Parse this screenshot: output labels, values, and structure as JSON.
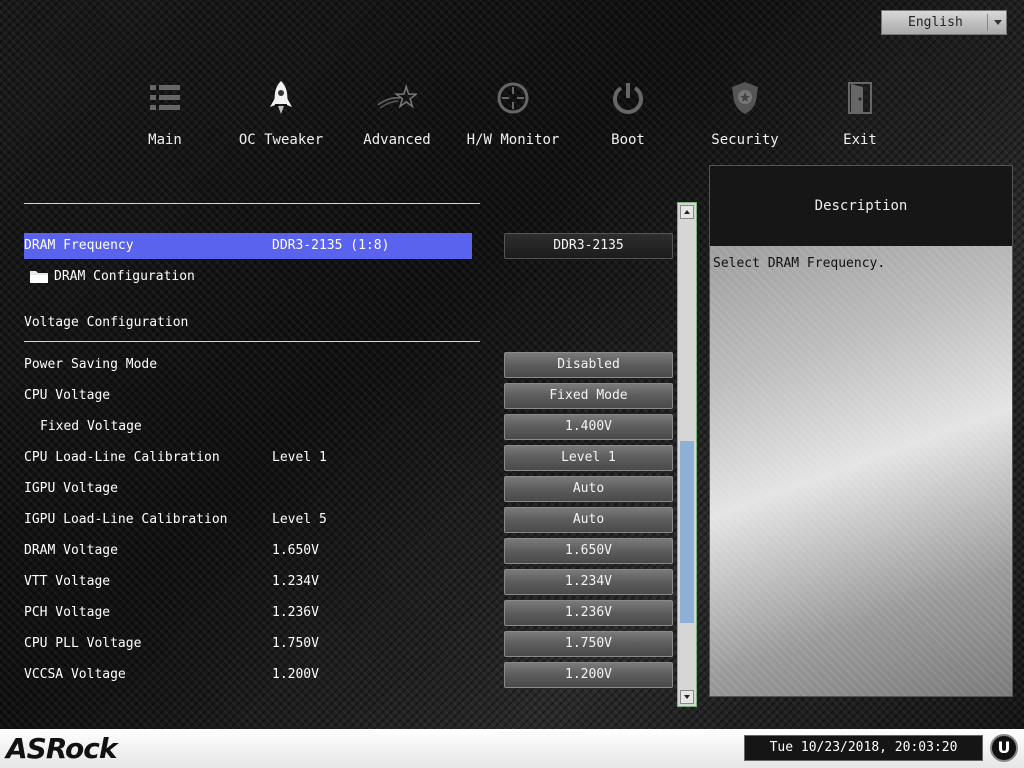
{
  "language": {
    "selected": "English"
  },
  "nav": {
    "items": [
      {
        "label": "Main",
        "icon": "list-icon"
      },
      {
        "label": "OC Tweaker",
        "icon": "rocket-icon"
      },
      {
        "label": "Advanced",
        "icon": "star-icon"
      },
      {
        "label": "H/W Monitor",
        "icon": "crosshair-icon"
      },
      {
        "label": "Boot",
        "icon": "power-icon"
      },
      {
        "label": "Security",
        "icon": "shield-icon"
      },
      {
        "label": "Exit",
        "icon": "door-icon"
      }
    ],
    "active": "OC Tweaker"
  },
  "settings": {
    "dram_frequency": {
      "label": "DRAM Frequency",
      "value": "DDR3-2135 (1:8)",
      "option": "DDR3-2135"
    },
    "dram_configuration": {
      "label": "DRAM Configuration"
    },
    "voltage_section": "Voltage Configuration",
    "rows": [
      {
        "label": "Power Saving Mode",
        "value": "",
        "option": "Disabled"
      },
      {
        "label": "CPU Voltage",
        "value": "",
        "option": "Fixed Mode"
      },
      {
        "label": "Fixed Voltage",
        "value": "",
        "option": "1.400V"
      },
      {
        "label": "CPU Load-Line Calibration",
        "value": "Level 1",
        "option": "Level 1"
      },
      {
        "label": "IGPU Voltage",
        "value": "",
        "option": "Auto"
      },
      {
        "label": "IGPU Load-Line Calibration",
        "value": "Level 5",
        "option": "Auto"
      },
      {
        "label": "DRAM Voltage",
        "value": "1.650V",
        "option": "1.650V"
      },
      {
        "label": "VTT Voltage",
        "value": "1.234V",
        "option": "1.234V"
      },
      {
        "label": "PCH Voltage",
        "value": "1.236V",
        "option": "1.236V"
      },
      {
        "label": "CPU PLL Voltage",
        "value": "1.750V",
        "option": "1.750V"
      },
      {
        "label": "VCCSA Voltage",
        "value": "1.200V",
        "option": "1.200V"
      }
    ]
  },
  "description": {
    "title": "Description",
    "text": "Select DRAM Frequency."
  },
  "footer": {
    "brand": "ASRock",
    "datetime": "Tue 10/23/2018, 20:03:20",
    "badge": "U"
  },
  "colors": {
    "highlight": "#5a63ee",
    "scroll_thumb": "#8fb0d6"
  }
}
